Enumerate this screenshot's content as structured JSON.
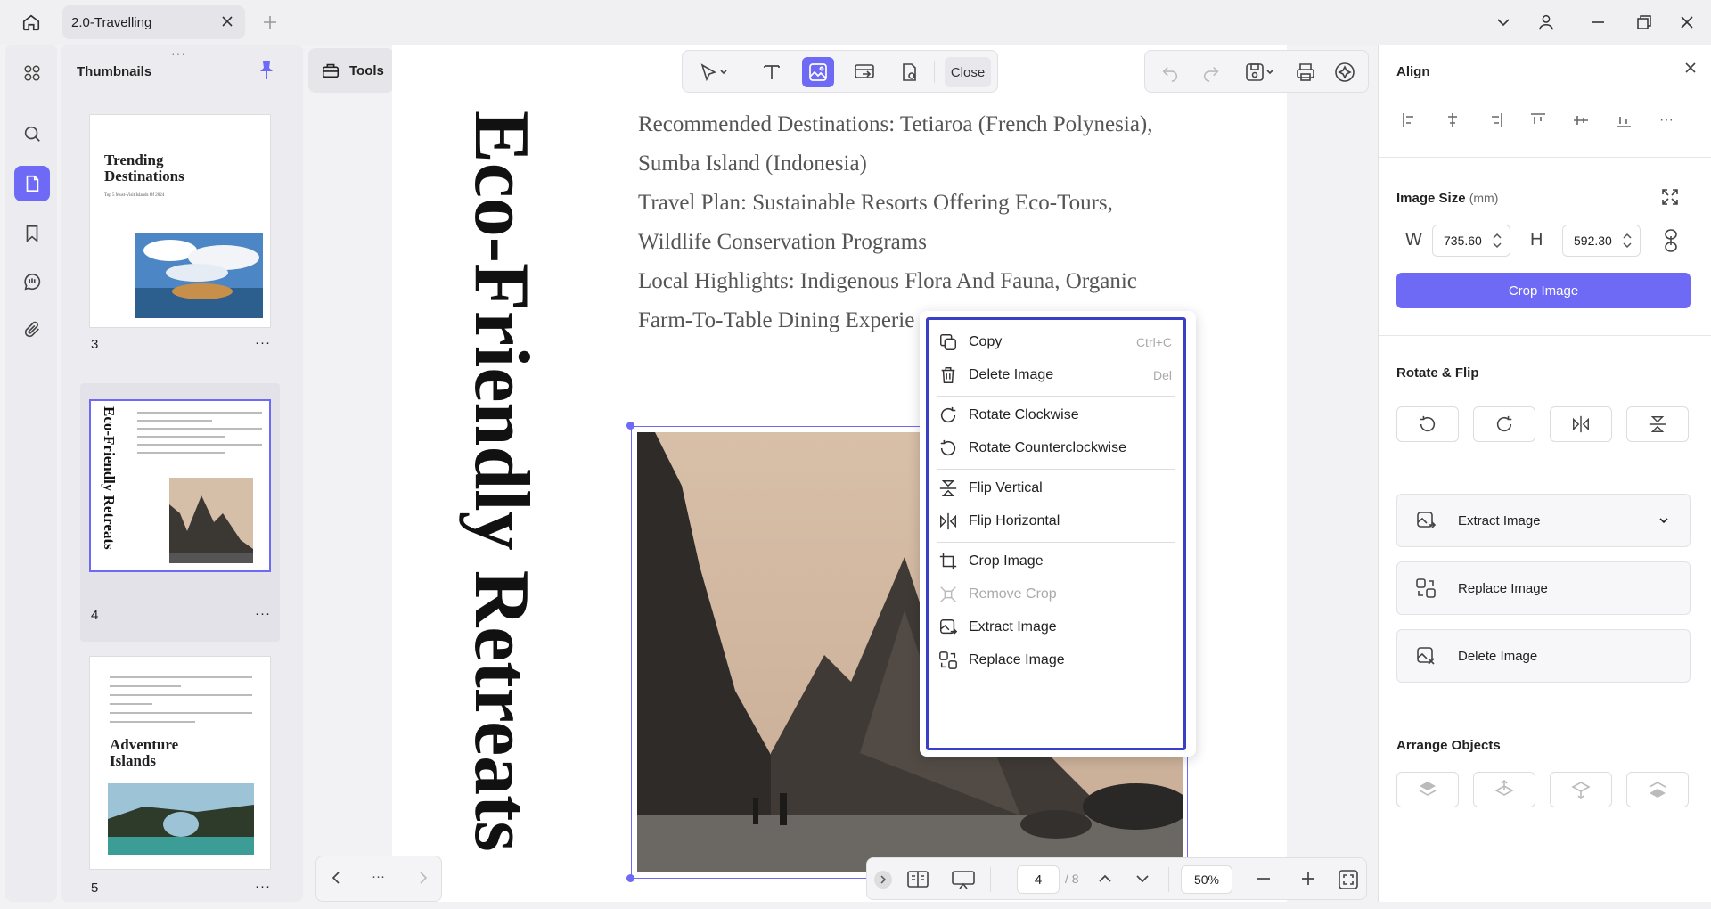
{
  "tab": {
    "title": "2.0-Travelling"
  },
  "thumbnails": {
    "header": "Thumbnails",
    "pages": [
      {
        "num": "3",
        "title": "Trending Destinations",
        "subtitle": "Top 5 Must-Visit Islands Of 2024"
      },
      {
        "num": "4",
        "title": "Eco-Friendly Retreats"
      },
      {
        "num": "5",
        "title": "Adventure Islands"
      }
    ],
    "more": "···"
  },
  "tools": {
    "label": "Tools"
  },
  "toolbar": {
    "close_label": "Close"
  },
  "document": {
    "vertical_title": "Eco-Friendly Retreats",
    "lines": [
      "Recommended Destinations: Tetiaroa (French Polynesia),",
      "Sumba Island (Indonesia)",
      "Travel Plan: Sustainable Resorts Offering Eco-Tours,",
      "Wildlife Conservation Programs",
      "Local Highlights: Indigenous Flora And Fauna, Organic",
      "Farm-To-Table Dining Experie"
    ]
  },
  "context_menu": {
    "items": [
      {
        "label": "Copy",
        "shortcut": "Ctrl+C",
        "icon": "copy-icon"
      },
      {
        "label": "Delete Image",
        "shortcut": "Del",
        "icon": "trash-icon"
      },
      {
        "label": "Rotate Clockwise",
        "icon": "rotate-cw-icon"
      },
      {
        "label": "Rotate Counterclockwise",
        "icon": "rotate-ccw-icon"
      },
      {
        "label": "Flip Vertical",
        "icon": "flip-vertical-icon"
      },
      {
        "label": "Flip Horizontal",
        "icon": "flip-horizontal-icon"
      },
      {
        "label": "Crop Image",
        "icon": "crop-icon"
      },
      {
        "label": "Remove Crop",
        "icon": "remove-crop-icon",
        "disabled": true
      },
      {
        "label": "Extract Image",
        "icon": "extract-image-icon"
      },
      {
        "label": "Replace Image",
        "icon": "replace-image-icon"
      }
    ]
  },
  "pagination": {
    "current": "4",
    "total": "/ 8",
    "zoom": "50%",
    "more": "···"
  },
  "right_panel": {
    "align_title": "Align",
    "image_size_title": "Image Size",
    "image_size_unit": "(mm)",
    "w_label": "W",
    "w_value": "735.60",
    "h_label": "H",
    "h_value": "592.30",
    "crop_button": "Crop Image",
    "rotate_flip_title": "Rotate & Flip",
    "extract_button": "Extract Image",
    "replace_button": "Replace Image",
    "delete_button": "Delete Image",
    "arrange_title": "Arrange Objects"
  },
  "colors": {
    "accent": "#6e6af5",
    "menu_border": "#3a3fc8"
  }
}
